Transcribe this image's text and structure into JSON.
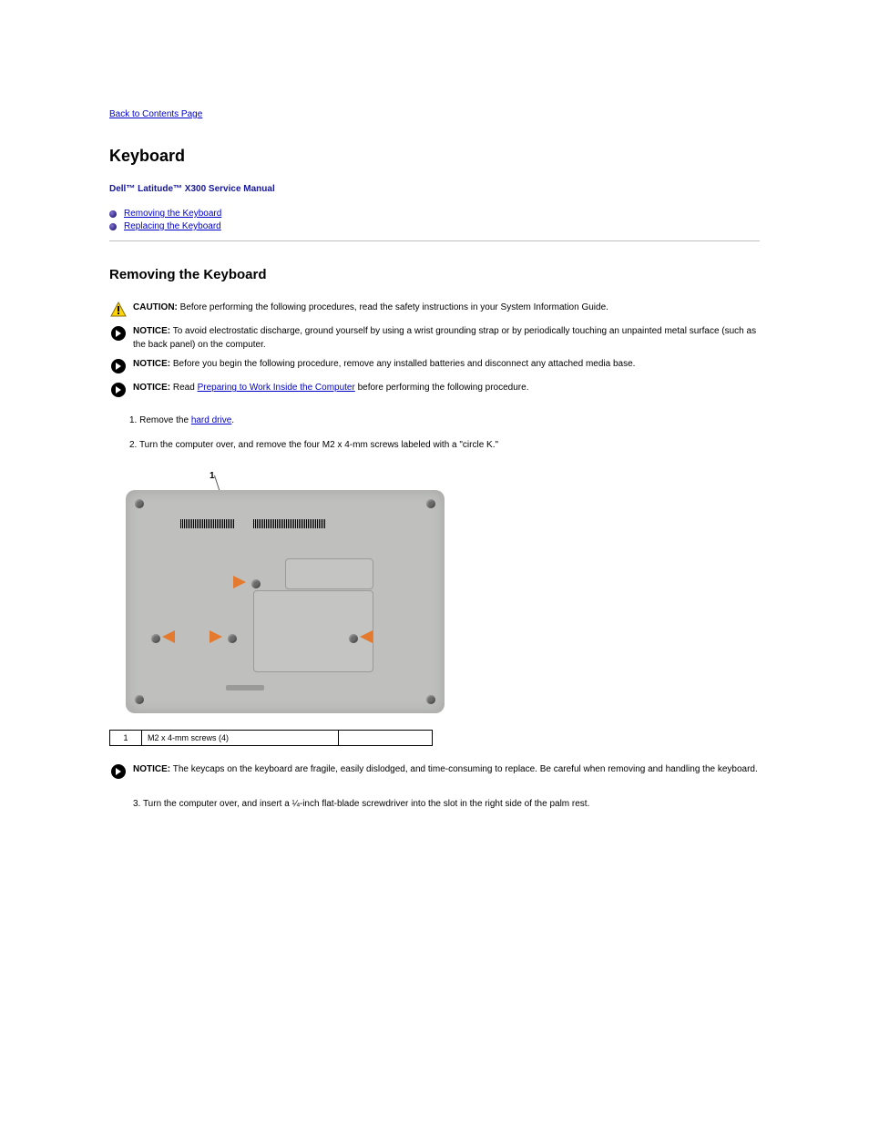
{
  "back_link": "Back to Contents Page",
  "main_heading": "Keyboard",
  "breadcrumb": "Dell™ Latitude™ X300 Service Manual",
  "toc": [
    {
      "label": "Removing the Keyboard"
    },
    {
      "label": "Replacing the Keyboard"
    }
  ],
  "section_heading": "Removing the Keyboard",
  "callouts": [
    {
      "type": "caution",
      "label": "CAUTION:",
      "text": "Before performing the following procedures, read the safety instructions in your System Information Guide."
    },
    {
      "type": "notice",
      "label": "NOTICE:",
      "text": "To avoid electrostatic discharge, ground yourself by using a wrist grounding strap or by periodically touching an unpainted metal surface (such as the back panel) on the computer."
    },
    {
      "type": "notice",
      "label": "NOTICE:",
      "text": "Before you begin the following procedure, remove any installed batteries and disconnect any attached media base."
    },
    {
      "type": "notice",
      "label": "NOTICE:",
      "text_prefix": "Read ",
      "link": "Preparing to Work Inside the Computer",
      "text_suffix": " before performing the following procedure."
    }
  ],
  "step1": {
    "prefix": "1. Remove the ",
    "link": "hard drive",
    "suffix": "."
  },
  "step2": "2. Turn the computer over, and remove the four M2 x 4-mm screws labeled with a \"circle K.\"",
  "photo": {
    "callout_num": "1"
  },
  "parts_table": {
    "num": "1",
    "desc": "M2 x 4-mm screws (4)"
  },
  "callout_last": {
    "label": "NOTICE:",
    "text": "The keycaps on the keyboard are fragile, easily dislodged, and time-consuming to replace. Be careful when removing and handling the keyboard."
  },
  "step3": "3. Turn the computer over, and insert a ¼-inch flat-blade screwdriver into the slot in the right side of the palm rest."
}
